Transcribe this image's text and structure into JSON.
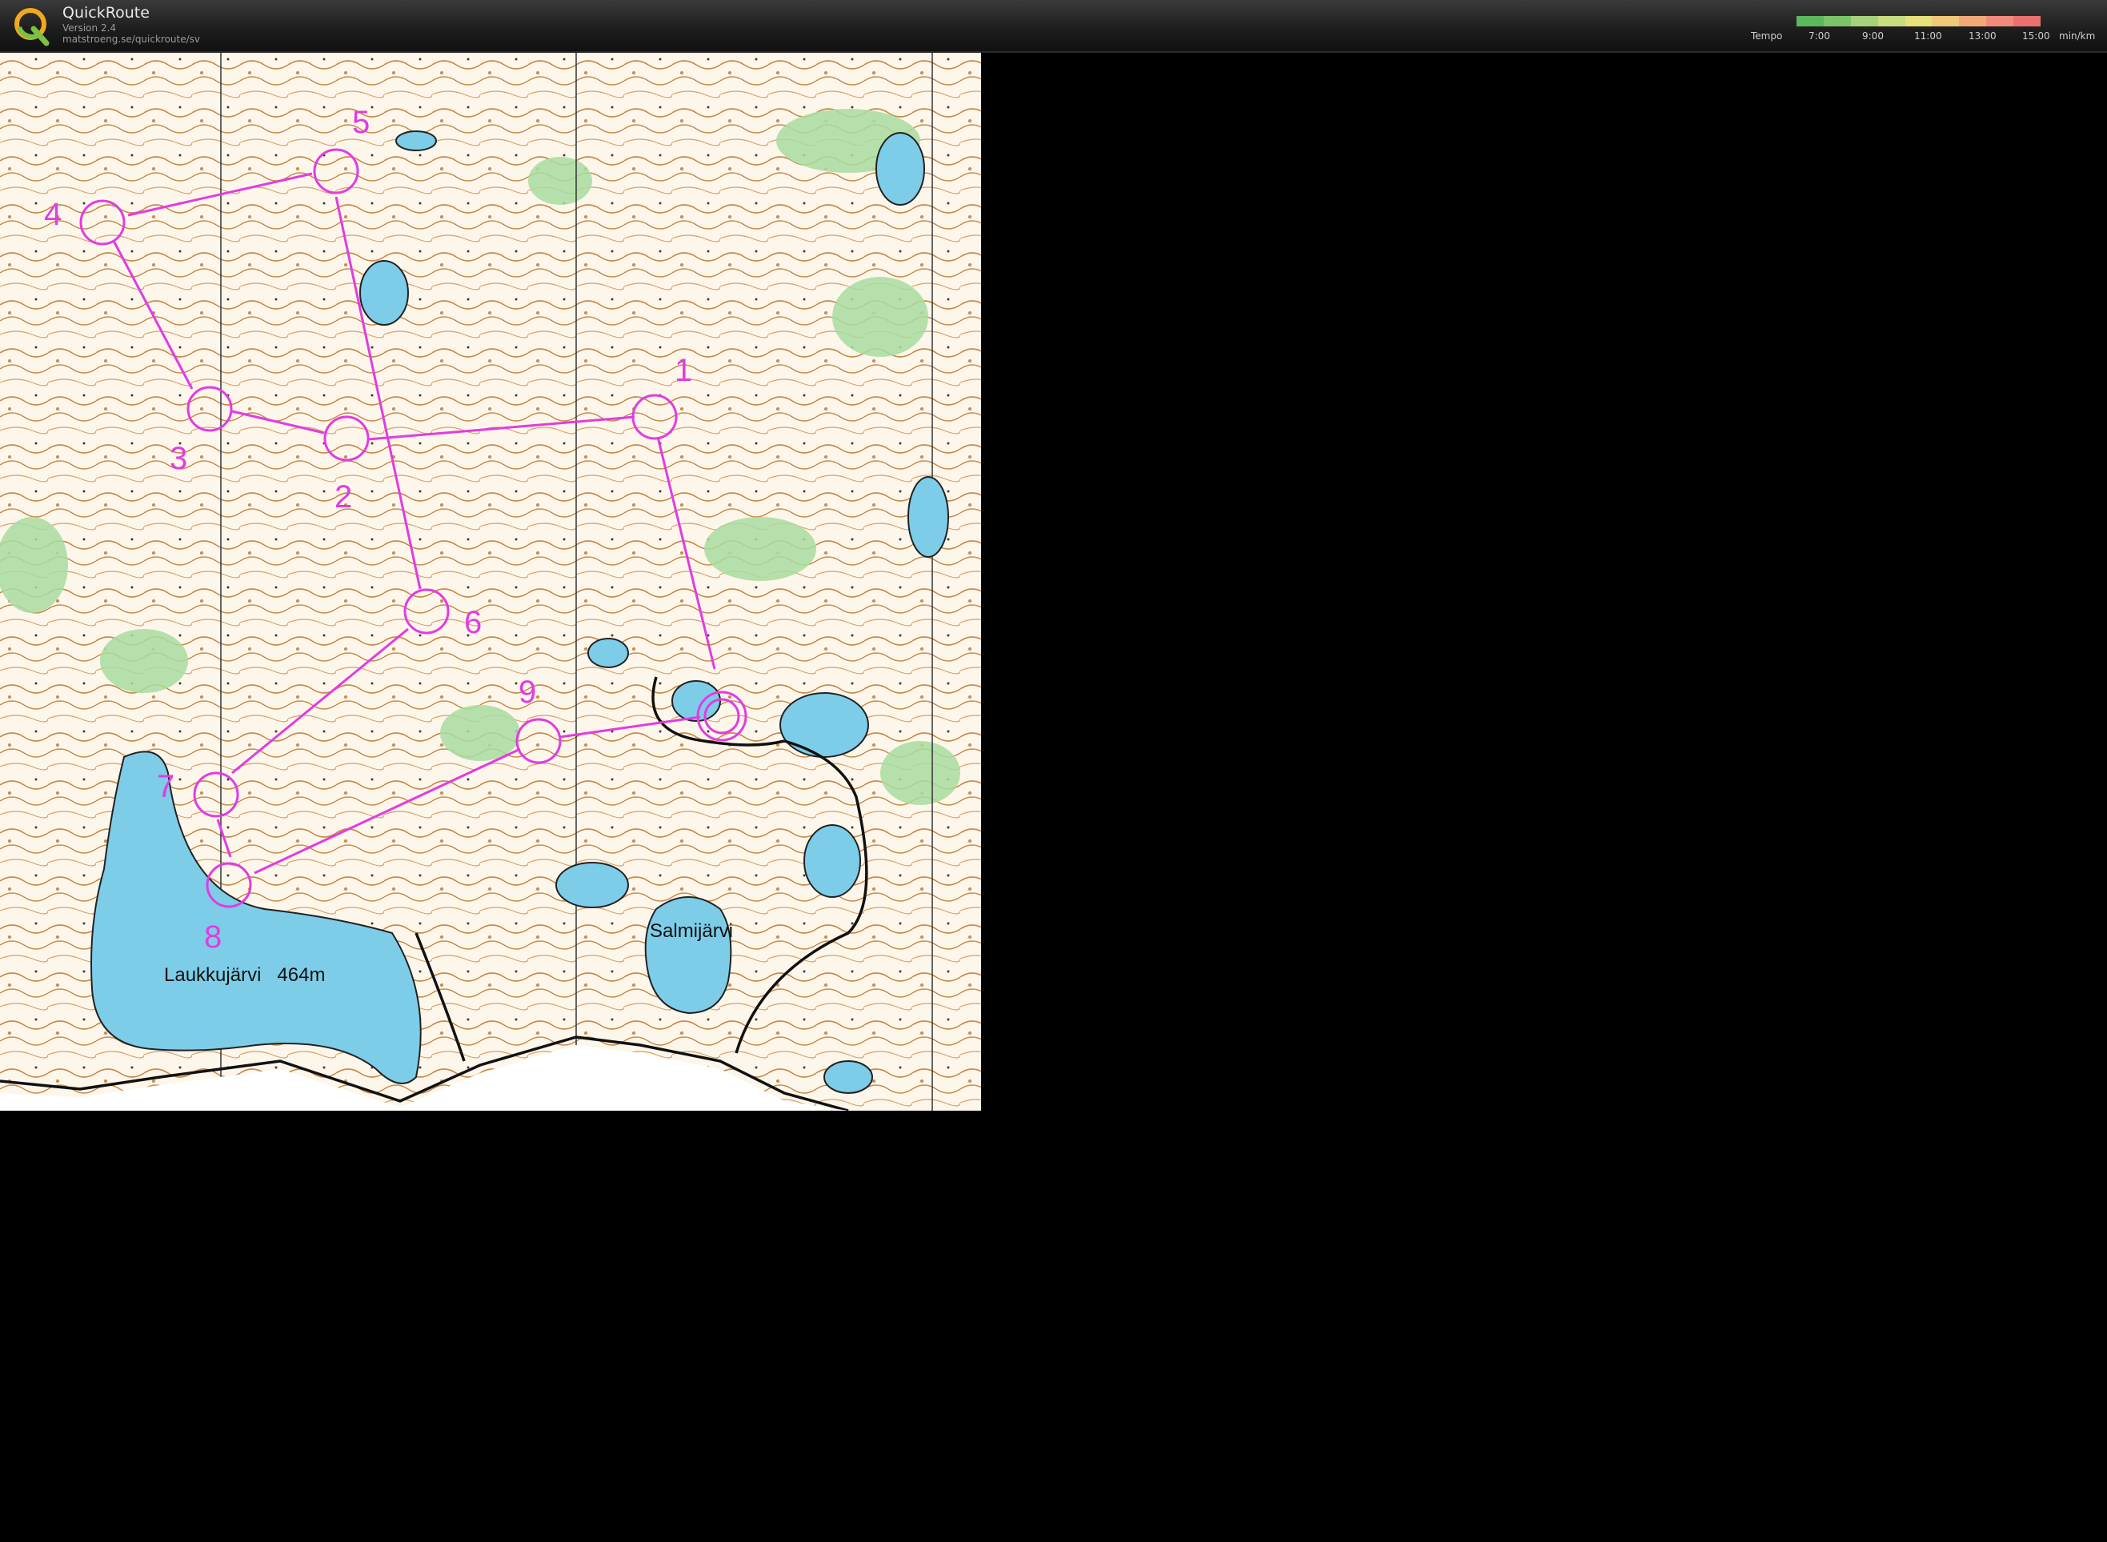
{
  "app": {
    "name": "QuickRoute",
    "version": "Version 2.4",
    "url": "matstroeng.se/quickroute/sv"
  },
  "tempo": {
    "label": "Tempo",
    "ticks": [
      "7:00",
      "9:00",
      "11:00",
      "13:00",
      "15:00"
    ],
    "unit": "min/km",
    "colors": [
      "#5cb85c",
      "#7cc46a",
      "#a5d27a",
      "#c8dc7e",
      "#e6e07a",
      "#f0c879",
      "#f2a978",
      "#f08a7a",
      "#ea7070"
    ]
  },
  "map": {
    "course_color": "#e13ce1",
    "lakes": {
      "laukkujarvi": "Laukkujärvi   464m",
      "salmijarvi": "Salmijärvi"
    },
    "controls": [
      "1",
      "2",
      "3",
      "4",
      "5",
      "6",
      "7",
      "8",
      "9"
    ]
  }
}
